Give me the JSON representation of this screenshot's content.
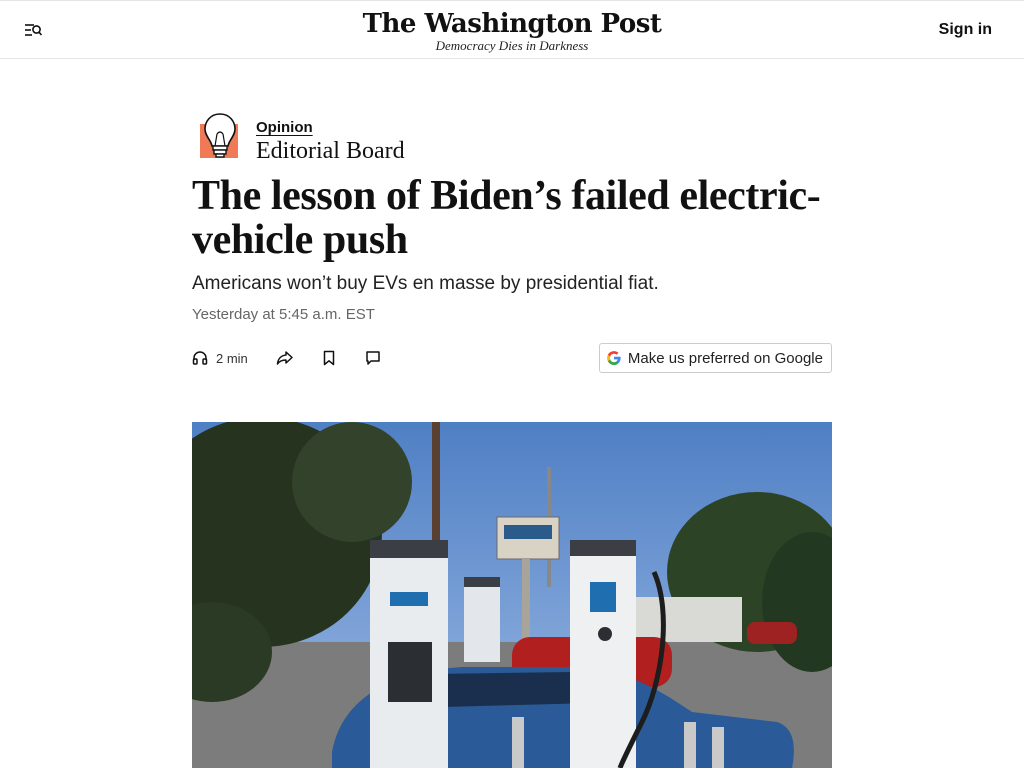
{
  "header": {
    "logo_text": "The Washington Post",
    "tagline": "Democracy Dies in Darkness",
    "sign_in_label": "Sign in",
    "menu_icon": "menu-search-icon"
  },
  "article": {
    "section": "Opinion",
    "author": "Editorial Board",
    "headline": "The lesson of Biden’s failed electric-vehicle push",
    "dek": "Americans won’t buy EVs en masse by presidential fiat.",
    "timestamp": "Yesterday at 5:45 a.m. EST",
    "section_icon": "lightbulb-icon",
    "accent_color": "#f07a55"
  },
  "actions": {
    "listen_label": "2 min",
    "listen_icon": "headphones-icon",
    "share_icon": "share-icon",
    "save_icon": "bookmark-icon",
    "comments_icon": "comment-icon",
    "google_label": "Make us preferred on Google",
    "google_icon": "google-g-icon"
  },
  "photo": {
    "subject": "electric-vehicle-charging-stations-image"
  }
}
